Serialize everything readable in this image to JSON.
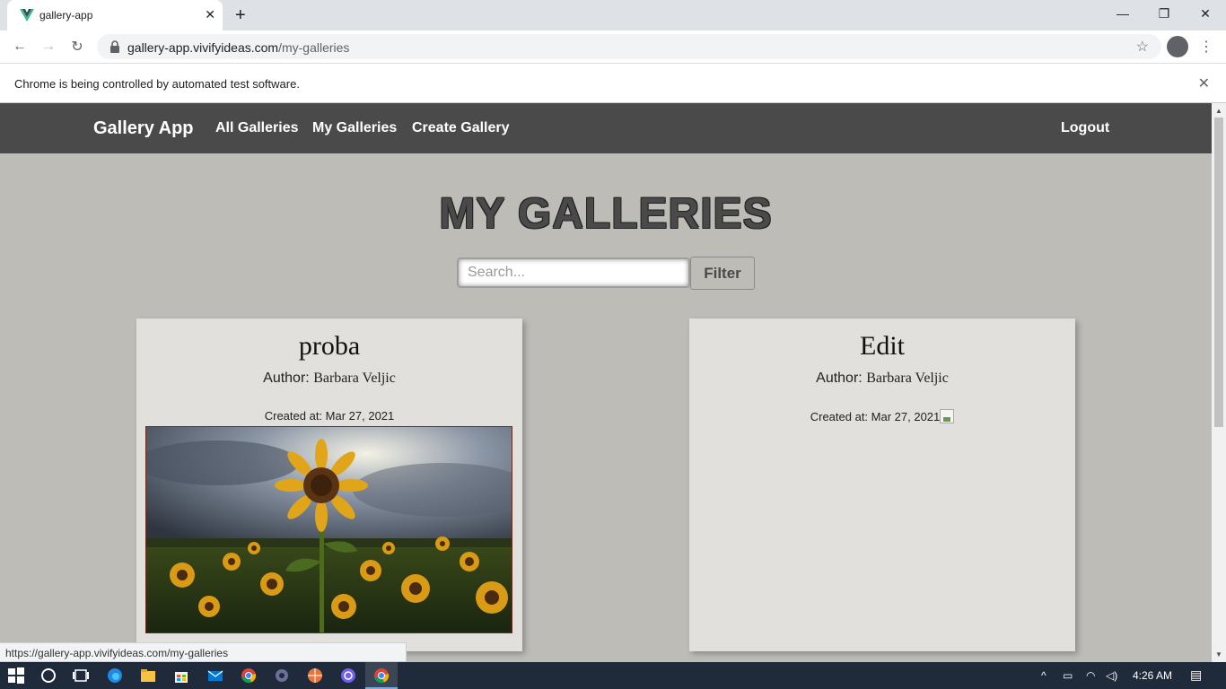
{
  "browser": {
    "tab_title": "gallery-app",
    "url_host": "gallery-app.vivifyideas.com",
    "url_path": "/my-galleries",
    "infobar_message": "Chrome is being controlled by automated test software.",
    "status_url": "https://gallery-app.vivifyideas.com/my-galleries"
  },
  "app": {
    "brand": "Gallery App",
    "nav": [
      "All Galleries",
      "My Galleries",
      "Create Gallery"
    ],
    "logout": "Logout",
    "heading": "MY GALLERIES",
    "search_placeholder": "Search...",
    "filter_label": "Filter"
  },
  "galleries": [
    {
      "title": "proba",
      "author_prefix": "Author:",
      "author": "Barbara Veljic",
      "created": "Created at: Mar 27, 2021",
      "image": "sunflower-field-photo"
    },
    {
      "title": "Edit",
      "author_prefix": "Author:",
      "author": "Barbara Veljic",
      "created": "Created at: Mar 27, 2021",
      "image": "broken-image"
    }
  ],
  "taskbar": {
    "time": "4:26 AM"
  },
  "colors": {
    "page_bg": "#bdbcb6",
    "nav_bg": "#4a4a4a",
    "card_bg": "#e1e0dc",
    "taskbar_bg": "#1f2a3a"
  }
}
